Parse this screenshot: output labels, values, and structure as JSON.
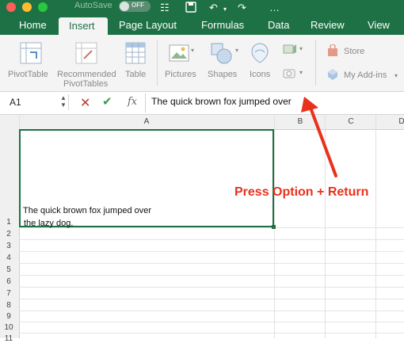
{
  "titlebar": {
    "autosave_label": "AutoSave",
    "autosave_state": "OFF",
    "icons": [
      "close-icon",
      "minimize-icon",
      "zoom-icon",
      "sidebar-icon",
      "save-icon",
      "undo-icon",
      "redo-icon",
      "more-icon"
    ]
  },
  "tabs": [
    "Home",
    "Insert",
    "Page Layout",
    "Formulas",
    "Data",
    "Review",
    "View"
  ],
  "active_tab": "Insert",
  "ribbon": {
    "pivottable": "PivotTable",
    "recommended_l1": "Recommended",
    "recommended_l2": "PivotTables",
    "table": "Table",
    "pictures": "Pictures",
    "shapes": "Shapes",
    "icons": "Icons",
    "store": "Store",
    "my_addins": "My Add-ins"
  },
  "formula_bar": {
    "name_box": "A1",
    "fx": "fx",
    "content": "The quick brown fox jumped over"
  },
  "grid": {
    "columns": [
      "A",
      "B",
      "C",
      "D"
    ],
    "rows": [
      "1",
      "2",
      "3",
      "4",
      "5",
      "6",
      "7",
      "8",
      "9",
      "10",
      "11"
    ],
    "cell_a1_line1": "The quick brown fox jumped over",
    "cell_a1_line2": " the lazy dog."
  },
  "annotation": {
    "text": "Press Option + Return",
    "color": "#e8321c"
  },
  "colors": {
    "excel_green": "#1e7145",
    "ribbon_bg": "#f4f4f4"
  }
}
